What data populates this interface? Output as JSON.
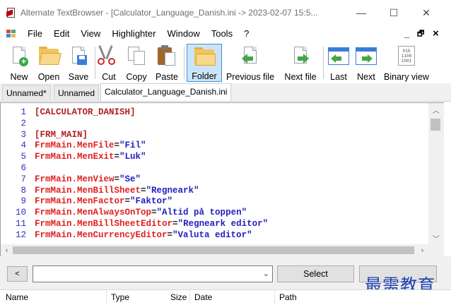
{
  "window": {
    "title": "Alternate TextBrowser - [Calculator_Language_Danish.ini -> 2023-02-07 15:5...",
    "controls": {
      "minimize": "—",
      "maximize": "☐",
      "close": "✕"
    }
  },
  "menu": {
    "items": [
      "File",
      "Edit",
      "View",
      "Highlighter",
      "Window",
      "Tools",
      "?"
    ],
    "child_controls": {
      "minimize": "_",
      "restore": "🗗",
      "close": "×"
    }
  },
  "toolbar": {
    "new": "New",
    "open": "Open",
    "save": "Save",
    "cut": "Cut",
    "copy": "Copy",
    "paste": "Paste",
    "folder": "Folder",
    "previous_file": "Previous file",
    "next_file": "Next file",
    "last": "Last",
    "next": "Next",
    "binary_view": "Binary view",
    "binary_icon_lines": [
      "010",
      "1100",
      "1001"
    ]
  },
  "tabs": [
    {
      "label": "Unnamed*"
    },
    {
      "label": "Unnamed"
    },
    {
      "label": "Calculator_Language_Danish.ini",
      "active": true
    }
  ],
  "editor": {
    "lines": [
      {
        "n": "1",
        "kind": "section",
        "text": "[CALCULATOR_DANISH]"
      },
      {
        "n": "2",
        "kind": "blank",
        "text": ""
      },
      {
        "n": "3",
        "kind": "section",
        "text": "[FRM_MAIN]"
      },
      {
        "n": "4",
        "kind": "pair",
        "key": "FrmMain.MenFile",
        "value": "\"Fil\""
      },
      {
        "n": "5",
        "kind": "pair",
        "key": "FrmMain.MenExit",
        "value": "\"Luk\""
      },
      {
        "n": "6",
        "kind": "blank",
        "text": ""
      },
      {
        "n": "7",
        "kind": "pair",
        "key": "FrmMain.MenView",
        "value": "\"Se\""
      },
      {
        "n": "8",
        "kind": "pair",
        "key": "FrmMain.MenBillSheet",
        "value": "\"Regneark\""
      },
      {
        "n": "9",
        "kind": "pair",
        "key": "FrmMain.MenFactor",
        "value": "\"Faktor\""
      },
      {
        "n": "10",
        "kind": "pair",
        "key": "FrmMain.MenAlwaysOnTop",
        "value": "\"Altid på toppen\""
      },
      {
        "n": "11",
        "kind": "pair",
        "key": "FrmMain.MenBillSheetEditor",
        "value": "\"Regneark editor\""
      },
      {
        "n": "12",
        "kind": "pair",
        "key": "FrmMain.MenCurrencyEditor",
        "value": "\"Valuta editor\""
      }
    ]
  },
  "search": {
    "back_arrow": "<",
    "query": "",
    "dropdown_arrow": "⌄",
    "select_label": "Select"
  },
  "file_list": {
    "columns": [
      "Name",
      "Type",
      "Size",
      "Date",
      "Path"
    ]
  },
  "watermark": "最需教育",
  "colors": {
    "key": "#e02020",
    "section": "#b02020",
    "value": "#2020c0",
    "line_number": "#3030c0",
    "active_tool": "#cce4f7"
  }
}
